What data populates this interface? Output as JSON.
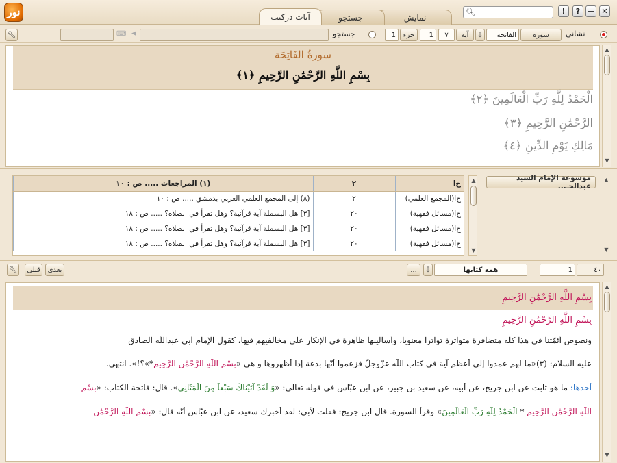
{
  "app": {
    "logo_text": "نور",
    "tabs": [
      {
        "label": "آيات درکتب",
        "active": true
      },
      {
        "label": "جستجو",
        "active": false
      },
      {
        "label": "نمايش",
        "active": false
      }
    ],
    "window_buttons": {
      "close": "✕",
      "minimize": "—",
      "help": "?",
      "info": "!"
    }
  },
  "toolbar": {
    "mode_display": "نشانی",
    "mode_search": "جستجو",
    "sura_label": "سوره",
    "sura_value": "الفاتحة",
    "aya_label": "آيه",
    "aya_value": "٧",
    "aya_num": "1",
    "juz_label": "جزء",
    "juz_value": "1"
  },
  "quran": {
    "sura_title": "سورةُ الفَاتِحَة",
    "basmala": "بِسْمِ اللَّهِ الرَّحْمَٰنِ الرَّحِيمِ ﴿١﴾",
    "verses": [
      "الْحَمْدُ لِلَّهِ رَبِّ الْعَالَمِينَ ﴿٢﴾",
      "الرَّحْمَٰنِ الرَّحِيمِ ﴿٣﴾",
      "مَالِكِ يَوْمِ الدِّينِ ﴿٤﴾"
    ]
  },
  "refs": {
    "book_title": "موسوعة الإمام السيد عبدالحـ...",
    "header": {
      "c1": "ج‌ا",
      "c2": "٢",
      "c3": "(١) المراجعات ..... ص : ١٠"
    },
    "rows": [
      {
        "c1": "ج‌ا(المجمع العلمي)",
        "c2": "٢",
        "c3": "(٨) إلى المجمع العلمي العربي بدمشق ..... ص : ١٠"
      },
      {
        "c1": "ج‌ا(مسائل فقهية)",
        "c2": "٢٠",
        "c3": "[٣] هل البسملة آية قرآنية؟ وهل تقرأ في الصلاة؟ ..... ص : ١٨"
      },
      {
        "c1": "ج‌ا(مسائل فقهية)",
        "c2": "٢٠",
        "c3": "[٣] هل البسملة آية قرآنية؟ وهل تقرأ في الصلاة؟ ..... ص : ١٨"
      },
      {
        "c1": "ج‌ا(مسائل فقهية)",
        "c2": "٢٠",
        "c3": "[٣] هل البسملة آية قرآنية؟ وهل تقرأ في الصلاة؟ ..... ص : ١٨"
      }
    ]
  },
  "nav": {
    "next": "بعدى",
    "prev": "قبلى",
    "scope_value": "همه کتابها",
    "more": "...",
    "page_value": "1",
    "page_total": "٤٠"
  },
  "text": {
    "heading": "بِسْمِ اللَّهِ الرَّحْمَٰنِ الرَّحِيمِ",
    "sub": "بِسْمِ اللَّهِ الرَّحْمَٰنِ الرَّحِيمِ",
    "p1": "ونصوص أئمّتنا في هذا كلّه متضافرة متواترة تواترا معنويا، وأساليبها ظاهرة في الإنكار على مخالفيهم فيها، كقول الإمام أبي عبداللّه الصادق",
    "p2a": "عليه السلام: (٣)«ما لهم عمدوا إلى أعظم آية في كتاب اللّه عزّوجلّ فزعموا أنّها بدعة إذا أظهروها و هي «",
    "p2b": "بِسْمِ اللَّهِ الرَّحْمَٰنِ الرَّحِيمِ",
    "p2c": "*»؟!». انتهى.",
    "p3a": "أحدها:",
    "p3b": " ما هو ثابت عن ابن جريج، عن أبيه، عن سعيد بن جبير، عن ابن عبّاس في قوله تعالى: «",
    "p3c": "وَ لَقَدْ آتَيْنَاكَ سَبْعاً مِنَ الْمَثَانِي",
    "p3d": "». قال: فاتحة الكتاب: «",
    "p3e": "بِسْمِ",
    "p4a": "اللَّهِ الرَّحْمَٰنِ الرَّحِيمِ",
    "p4b": " * ",
    "p4c": "الْحَمْدُ لِلَّهِ رَبِّ الْعَالَمِينَ",
    "p4d": "» وقرأ السورة. قال ابن جريج: فقلت لأبي: لقد أخبرك سعيد، عن ابن عبّاس أنّه قال: «",
    "p4e": "بِسْمِ اللَّهِ الرَّحْمَٰنِ"
  },
  "colors": {
    "accent": "#d91f1f",
    "quran_green": "#2e7d32",
    "quran_pink": "#c2185b",
    "label_blue": "#1565c0"
  }
}
